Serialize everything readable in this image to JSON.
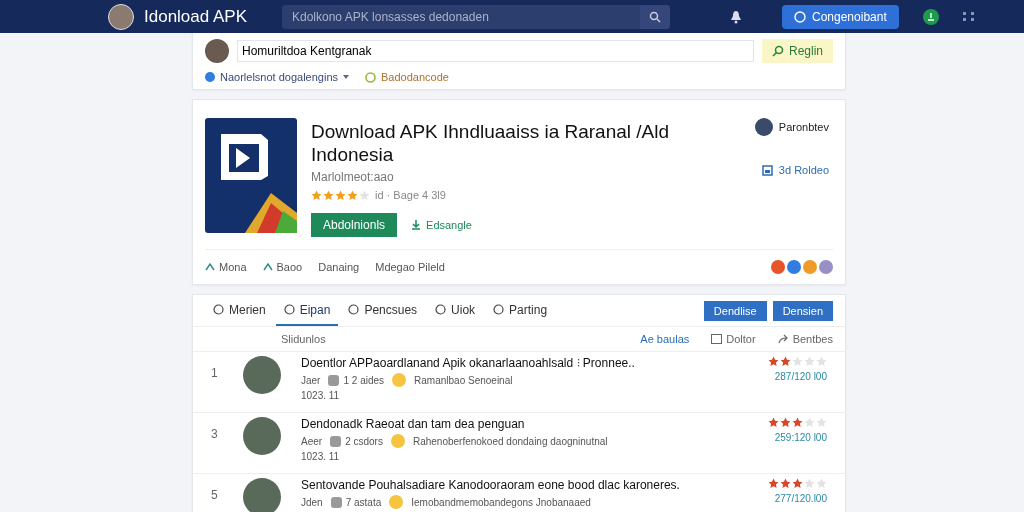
{
  "topbar": {
    "title": "Idonload APK",
    "search": {
      "placeholder": "Kdolkono APK lonsasses dedonaden"
    },
    "button": "Congenoibant"
  },
  "search_card": {
    "value": "Homuriltdoa Kentgranak",
    "button": "Reglin",
    "filters": [
      {
        "label": "Naorlelsnot dogalengins",
        "kind": "dropdown"
      },
      {
        "label": "Badodancode",
        "kind": "tag"
      }
    ]
  },
  "app": {
    "title": "Download APK Ihndluaaiss ia Raranal /Ald Indonesia",
    "subtitle": "Marlolmeot:aao",
    "stars": 4,
    "rating_text": "id · Bage 4 3l9",
    "install_button": "Abdolnionls",
    "share_link": "Edsangle",
    "author": "Paronbtev",
    "saved": "3d Roldeo",
    "links": [
      {
        "label": "Mona",
        "kind": "icon"
      },
      {
        "label": "Baoo",
        "kind": "icon"
      },
      {
        "label": "Danaing",
        "kind": "plain"
      },
      {
        "label": "Mdegao Pileld",
        "kind": "plain"
      }
    ],
    "dots": [
      {
        "color": "#e8542a"
      },
      {
        "color": "#2f7de1"
      },
      {
        "color": "#f09a2a"
      },
      {
        "color": "#9a8fc4"
      }
    ]
  },
  "reviews": {
    "tabs": [
      {
        "label": "Merien",
        "selected": false
      },
      {
        "label": "Eipan",
        "selected": true
      },
      {
        "label": "Pencsues",
        "selected": false
      },
      {
        "label": "Uiok",
        "selected": false
      },
      {
        "label": "Parting",
        "selected": false
      }
    ],
    "buttons": [
      "Dendlise",
      "Densien"
    ],
    "count": "Slidunlos",
    "sort_link": "Ae baulas",
    "filter": "Doltor",
    "share": "Bentbes",
    "rows": [
      {
        "index": "1",
        "title": "Doentlor APPaoardlanand Apik okanarlaanoahlsald ⫶ Pronnee..",
        "author": "Jaer",
        "comments": "1 2 aides",
        "meta": "Ramanlbao Senoeinal",
        "date": "1023.  11",
        "stars": 2,
        "price": "287/120 l00"
      },
      {
        "index": "3",
        "title": "Dendonadk Raeoat dan tam dea penguan",
        "author": "Aeer",
        "comments": "2 csdors",
        "meta": "Rahenoberfenokoed dondaing daogninutnal",
        "date": "1023.  11",
        "stars": 3,
        "price": "259:120 l00"
      },
      {
        "index": "5",
        "title": "Sentovande Pouhalsadiare Kanodooraoram eone bood dlac karoneres.",
        "author": "Jden",
        "comments": "7 astata",
        "meta": "Iemobandmemobandegons Jnobanaaed",
        "stars": 3,
        "price": "277/120.l00"
      }
    ]
  }
}
